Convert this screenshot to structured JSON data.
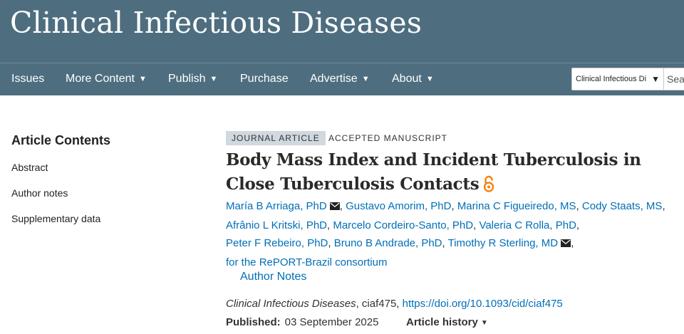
{
  "header": {
    "site_title": "Clinical Infectious Diseases"
  },
  "nav": {
    "items": [
      {
        "label": "Issues",
        "dropdown": false
      },
      {
        "label": "More Content",
        "dropdown": true
      },
      {
        "label": "Publish",
        "dropdown": true
      },
      {
        "label": "Purchase",
        "dropdown": false
      },
      {
        "label": "Advertise",
        "dropdown": true
      },
      {
        "label": "About",
        "dropdown": true
      }
    ],
    "caret": "▼"
  },
  "search": {
    "scope_value": "Clinical Infectious Di",
    "scope_caret": "▼",
    "placeholder": "Search"
  },
  "sidebar": {
    "title": "Article Contents",
    "links": [
      "Abstract",
      "Author notes",
      "Supplementary data"
    ]
  },
  "article": {
    "type_badge": "JOURNAL ARTICLE",
    "status_badge": "ACCEPTED MANUSCRIPT",
    "title": "Body Mass Index and Incident Tuberculosis in Close Tuberculosis Contacts",
    "authors": [
      "María B Arriaga, PhD",
      "Gustavo Amorim, PhD",
      "Marina C Figueiredo, MS",
      "Cody Staats, MS",
      "Afrânio L Kritski, PhD",
      "Marcelo Cordeiro-Santo, PhD",
      "Valeria C Rolla, PhD",
      "Peter F Rebeiro, PhD",
      "Bruno B Andrade, PhD",
      "Timothy R Sterling, MD"
    ],
    "consortium": "for the RePORT-Brazil consortium",
    "author_notes_label": "Author Notes",
    "citation": {
      "journal": "Clinical Infectious Diseases",
      "id_text": ", ciaf475, ",
      "doi": "https://doi.org/10.1093/cid/ciaf475"
    },
    "published_label": "Published:",
    "published_date": "03 September 2025",
    "history_label": "Article history",
    "history_caret": "▼"
  },
  "colors": {
    "header_bg": "#4e6e80",
    "link": "#006fb7",
    "open_access_orange": "#f68212",
    "badge_bg": "#d0d8e0"
  },
  "icons": {
    "open_access": "open-access-lock-icon",
    "corresponding_author": "envelope-icon"
  }
}
